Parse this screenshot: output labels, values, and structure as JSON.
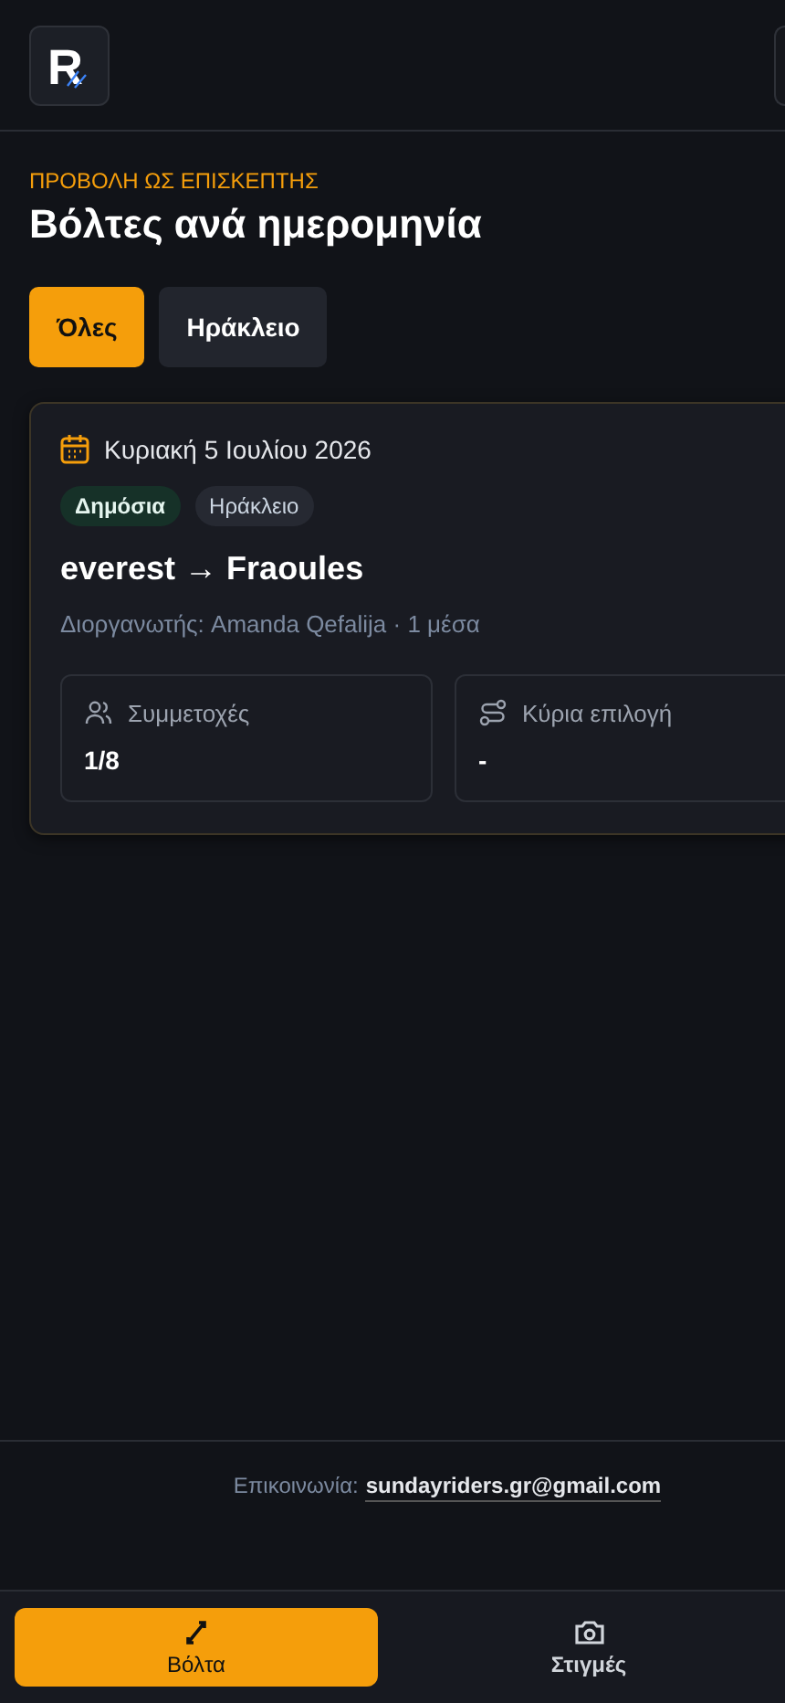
{
  "header": {
    "logo": "R"
  },
  "eyebrow": "ΠΡΟΒΟΛΗ ΩΣ ΕΠΙΣΚΕΠΤΗΣ",
  "title": "Βόλτες ανά ημερομηνία",
  "filters": [
    {
      "label": "Όλες",
      "selected": true
    },
    {
      "label": "Ηράκλειο",
      "selected": false
    }
  ],
  "rides": [
    {
      "date": "Κυριακή 5 Ιουλίου 2026",
      "tags": [
        {
          "label": "Δημόσια",
          "kind": "status"
        },
        {
          "label": "Ηράκλειο",
          "kind": "city"
        }
      ],
      "route": "everest → Fraoules",
      "meta": "Διοργανωτής: Amanda Qefalija · 1 μέσα",
      "stats": [
        {
          "kind": "people",
          "label": "Συμμετοχές",
          "value": "1/8"
        },
        {
          "kind": "route",
          "label": "Κύρια επιλογή",
          "value": "-"
        }
      ]
    }
  ],
  "footer": {
    "label": "Επικοινωνία:",
    "email": "sundayriders.gr@gmail.com"
  },
  "nav": [
    {
      "label": "Βόλτα",
      "kind": "ride",
      "selected": true
    },
    {
      "label": "Στιγμές",
      "kind": "camera",
      "selected": false
    }
  ]
}
